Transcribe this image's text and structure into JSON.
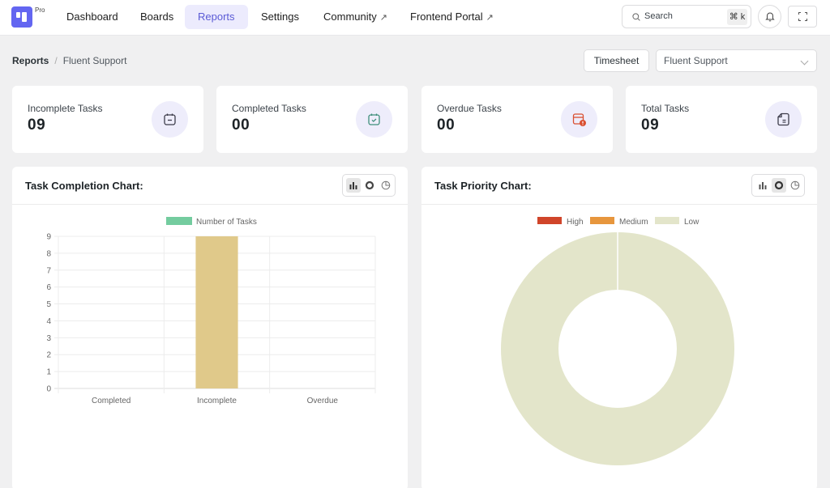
{
  "app": {
    "logo_badge": "Pro",
    "nav": [
      {
        "label": "Dashboard",
        "active": false,
        "external": false
      },
      {
        "label": "Boards",
        "active": false,
        "external": false
      },
      {
        "label": "Reports",
        "active": true,
        "external": false
      },
      {
        "label": "Settings",
        "active": false,
        "external": false
      },
      {
        "label": "Community",
        "active": false,
        "external": true
      },
      {
        "label": "Frontend Portal",
        "active": false,
        "external": true
      }
    ],
    "external_glyph": "↗",
    "search": {
      "placeholder": "Search",
      "shortcut": "⌘ k",
      "icon": "search-icon"
    },
    "notifications_icon": "bell-icon",
    "fullscreen_icon": "fullscreen-icon"
  },
  "breadcrumb": {
    "root": "Reports",
    "separator": "/",
    "current": "Fluent Support"
  },
  "toolbar": {
    "timesheet_label": "Timesheet",
    "board_select_value": "Fluent Support"
  },
  "stats": [
    {
      "label": "Incomplete Tasks",
      "value": "09",
      "icon": "calendar-minus-icon",
      "icon_color": "#3c3c4a"
    },
    {
      "label": "Completed Tasks",
      "value": "00",
      "icon": "calendar-check-icon",
      "icon_color": "#3f8f7b"
    },
    {
      "label": "Overdue Tasks",
      "value": "00",
      "icon": "calendar-alert-icon",
      "icon_color": "#d94f30"
    },
    {
      "label": "Total Tasks",
      "value": "09",
      "icon": "note-icon",
      "icon_color": "#3c3c4a"
    }
  ],
  "panels": {
    "completion": {
      "title": "Task Completion Chart:",
      "active_type": "bar",
      "types": [
        "bar",
        "doughnut",
        "pie"
      ]
    },
    "priority": {
      "title": "Task Priority Chart:",
      "active_type": "doughnut",
      "types": [
        "bar",
        "doughnut",
        "pie"
      ]
    }
  },
  "chart_data": [
    {
      "type": "bar",
      "title": "Task Completion Chart:",
      "categories": [
        "Completed",
        "Incomplete",
        "Overdue"
      ],
      "series": [
        {
          "name": "Number of Tasks",
          "values": [
            0,
            9,
            0
          ],
          "legend_color": "#74cc9f",
          "bar_color": "#e0c98a"
        }
      ],
      "xlabel": "",
      "ylabel": "",
      "ylim": [
        0,
        9
      ],
      "yticks": [
        0,
        1,
        2,
        3,
        4,
        5,
        6,
        7,
        8,
        9
      ],
      "grid": true,
      "legend": "top-center"
    },
    {
      "type": "pie",
      "variant": "doughnut",
      "title": "Task Priority Chart:",
      "labels": [
        "High",
        "Medium",
        "Low"
      ],
      "values": [
        0,
        0,
        9
      ],
      "colors": [
        "#d0452a",
        "#e7963d",
        "#e3e5ca"
      ],
      "legend": "top-center"
    }
  ]
}
